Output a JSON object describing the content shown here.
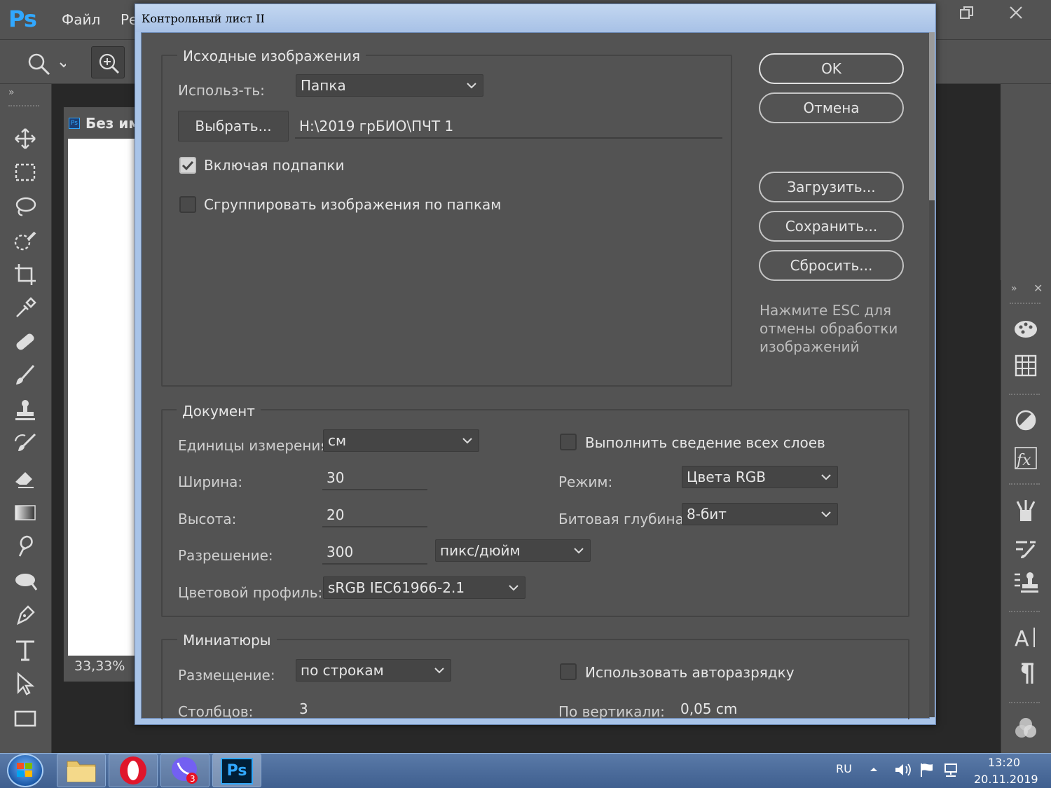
{
  "app": {
    "logo": "Ps",
    "menu_file": "Файл",
    "menu_edit_partial": "Ре"
  },
  "document": {
    "title_partial": "Без им",
    "zoom": "33,33%"
  },
  "dialog": {
    "title": "Контрольный лист II",
    "source": {
      "group_title": "Исходные изображения",
      "use_label": "Использ-ть:",
      "use_value": "Папка",
      "choose_button": "Выбрать...",
      "path": "H:\\2019 грБИО\\ПЧТ 1",
      "include_subfolders_label": "Включая подпапки",
      "include_subfolders_checked": true,
      "group_by_folder_label": "Сгруппировать изображения по папкам",
      "group_by_folder_checked": false
    },
    "buttons": {
      "ok": "OK",
      "cancel": "Отмена",
      "load": "Загрузить...",
      "save": "Сохранить...",
      "reset": "Сбросить..."
    },
    "esc_hint": "Нажмите ESC для отмены обработки изображений",
    "document": {
      "group_title": "Документ",
      "units_label": "Единицы измерения:",
      "units_value": "см",
      "width_label": "Ширина:",
      "width_value": "30",
      "height_label": "Высота:",
      "height_value": "20",
      "resolution_label": "Разрешение:",
      "resolution_value": "300",
      "resolution_unit": "пикс/дюйм",
      "profile_label": "Цветовой профиль:",
      "profile_value": "sRGB IEC61966-2.1",
      "flatten_label": "Выполнить сведение всех слоев",
      "flatten_checked": false,
      "mode_label": "Режим:",
      "mode_value": "Цвета RGB",
      "depth_label": "Битовая глубина:",
      "depth_value": "8-бит"
    },
    "thumbnails": {
      "group_title": "Миниатюры",
      "placement_label": "Размещение:",
      "placement_value": "по строкам",
      "columns_label": "Столбцов:",
      "columns_value": "3",
      "autospacing_label": "Использовать авторазрядку",
      "autospacing_checked": false,
      "vertical_label": "По вертикали:",
      "vertical_value": "0,05 cm"
    }
  },
  "taskbar": {
    "apps": [
      "explorer-icon",
      "opera-icon",
      "viber-icon",
      "photoshop-icon"
    ],
    "viber_badge": "3",
    "photoshop_label": "Ps",
    "lang": "RU",
    "time": "13:20",
    "date": "20.11.2019"
  },
  "colors": {
    "ps_blue": "#31a8ff",
    "panel_bg": "#535353",
    "dialog_frame": "#a9c4e8"
  }
}
